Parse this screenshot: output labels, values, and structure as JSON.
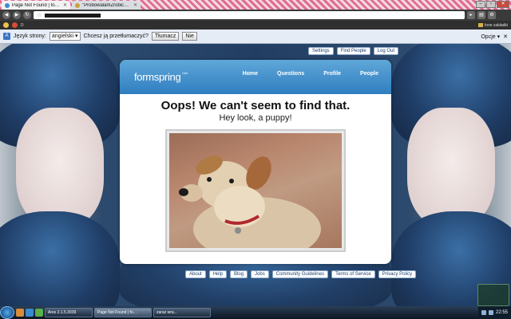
{
  "browser": {
    "tabs": [
      {
        "label": "Page Not Found | formsp...",
        "active": true
      },
      {
        "label": "\"ProbowalamZrobicZdje...",
        "active": false
      }
    ],
    "bookmark_other": "Inne zakładki",
    "bookmark_first": "D"
  },
  "translate_bar": {
    "lang_label": "Język strony:",
    "lang_value": "angielski",
    "question": "Chcesz ją przetłumaczyć?",
    "translate_btn": "Tłumacz",
    "no_btn": "Nie",
    "options": "Opcje"
  },
  "topnav": [
    "Settings",
    "Find People",
    "Log Out"
  ],
  "site": {
    "logo": "formspring",
    "logo_tag": "beta",
    "nav": [
      "Home",
      "Questions",
      "Profile",
      "People"
    ]
  },
  "error": {
    "title": "Oops! We can't seem to find that.",
    "subtitle": "Hey look, a puppy!"
  },
  "footer": [
    "About",
    "Help",
    "Blog",
    "Jobs",
    "Community Guidelines",
    "Terms of Service",
    "Privacy Policy"
  ],
  "taskbar": {
    "tasks": [
      {
        "label": "Ares 2.1.5.3039",
        "active": false
      },
      {
        "label": "Page Not Found | fo...",
        "active": true
      },
      {
        "label": "zaraz wra...",
        "active": false
      }
    ],
    "clock": "22:55"
  },
  "colors": {
    "header_blue": "#2f7ec0",
    "tab_stripe": "#e06d8f"
  }
}
